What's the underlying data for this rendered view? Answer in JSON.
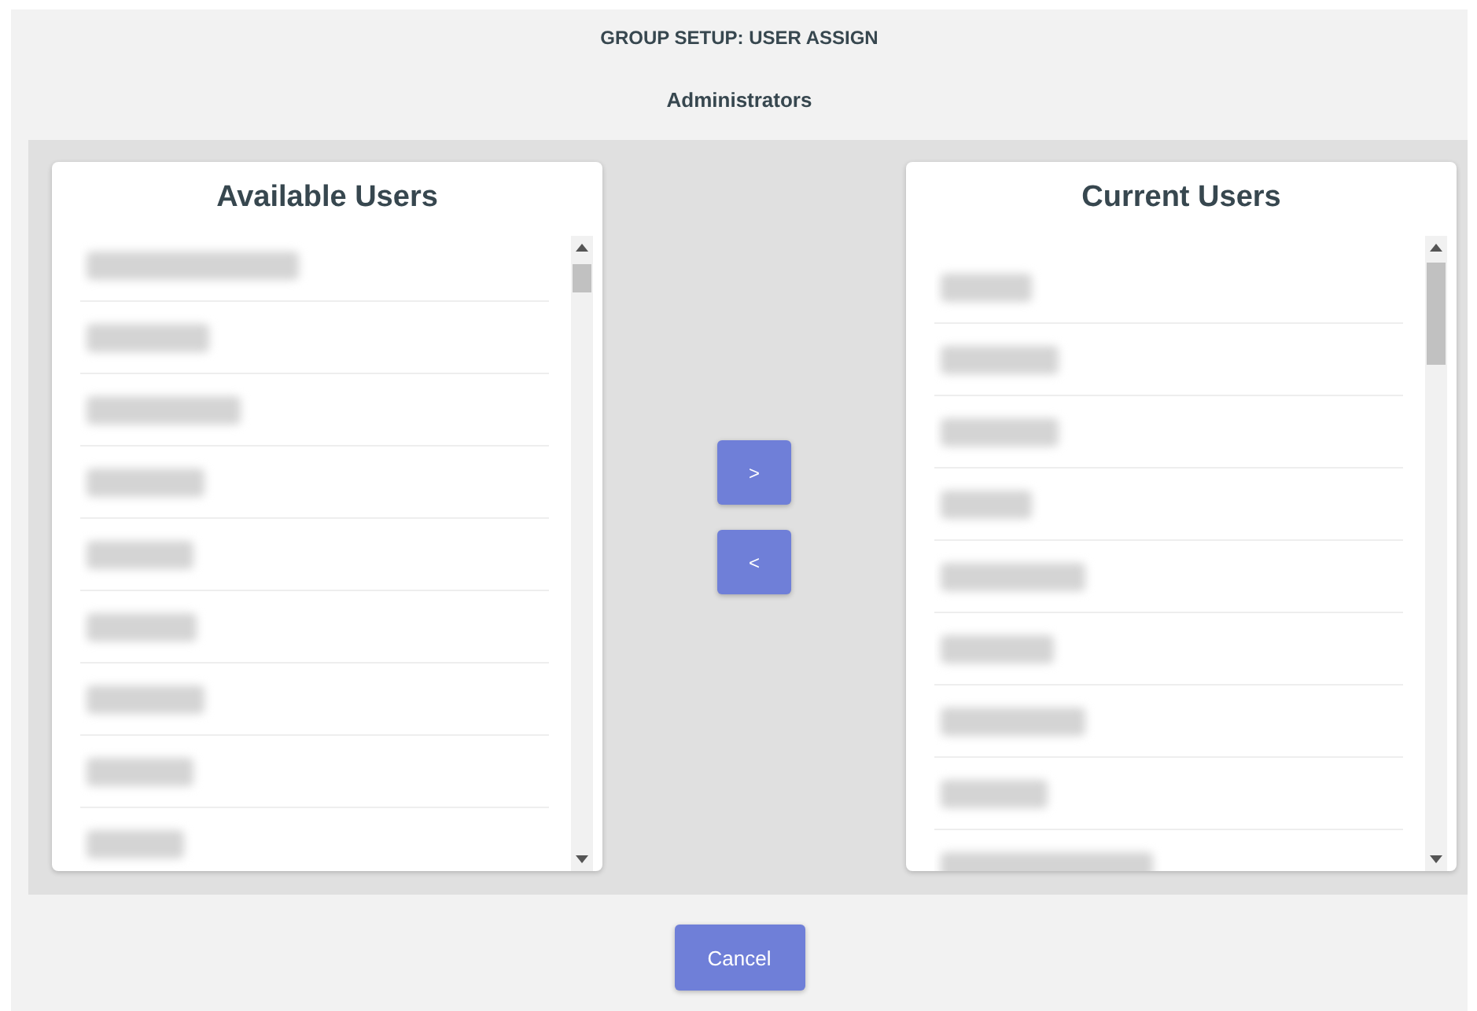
{
  "header": {
    "title": "GROUP SETUP: USER ASSIGN",
    "group": "Administrators"
  },
  "available_users": {
    "title": "Available Users",
    "items": [
      {
        "kind": "redacted"
      },
      {
        "kind": "redacted"
      },
      {
        "kind": "redacted"
      },
      {
        "kind": "redacted"
      },
      {
        "kind": "redacted"
      },
      {
        "kind": "redacted"
      },
      {
        "kind": "redacted"
      },
      {
        "kind": "redacted"
      },
      {
        "kind": "redacted"
      }
    ]
  },
  "transfer_buttons": [
    {
      "label": ">"
    },
    {
      "label": "<"
    }
  ],
  "current_users": {
    "title": "Current Users",
    "items": [
      {
        "kind": "redacted"
      },
      {
        "kind": "redacted"
      },
      {
        "kind": "redacted"
      },
      {
        "kind": "redacted"
      },
      {
        "kind": "redacted"
      },
      {
        "kind": "redacted"
      },
      {
        "kind": "redacted"
      },
      {
        "kind": "redacted"
      },
      {
        "kind": "redacted"
      }
    ]
  },
  "footer": {
    "cancel": "Cancel"
  }
}
